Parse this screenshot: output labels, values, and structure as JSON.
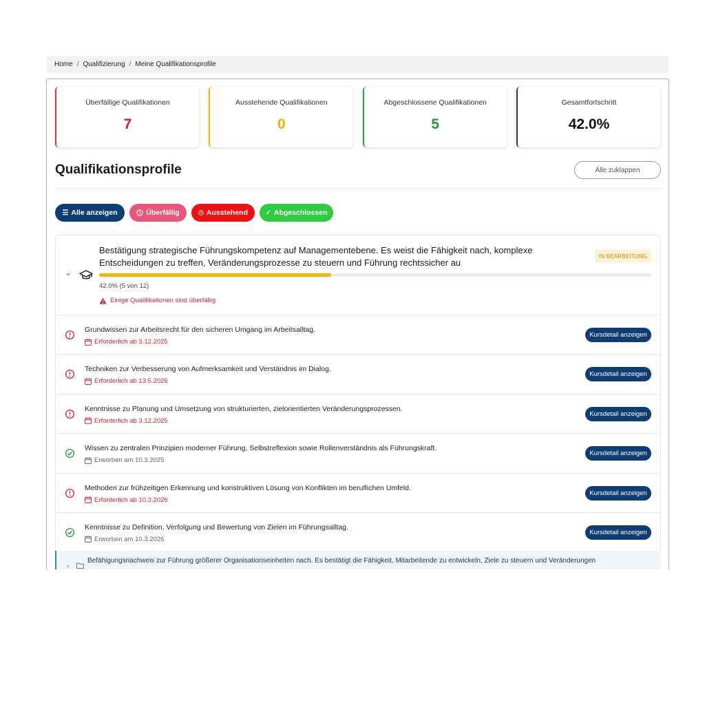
{
  "breadcrumb": [
    "Home",
    "Qualifizierung",
    "Meine Qualifikationsprofile"
  ],
  "stats": [
    {
      "label": "Überfällige Qualifikationen",
      "value": "7",
      "color": "#dc3545"
    },
    {
      "label": "Ausstehende Qualifikationen",
      "value": "0",
      "color": "#f5b800"
    },
    {
      "label": "Abgeschlossene Qualifikationen",
      "value": "5",
      "color": "#28a745"
    },
    {
      "label": "Gesamtfortschritt",
      "value": "42.0%",
      "color": "#2f3e4e"
    }
  ],
  "section": {
    "title": "Qualifikationsprofile",
    "collapse_label": "Alle zuklappen"
  },
  "filters": [
    {
      "label": "Alle anzeigen",
      "icon": "list-icon"
    },
    {
      "label": "Überfällig",
      "icon": "alert-circle-icon"
    },
    {
      "label": "Ausstehend",
      "icon": "clock-icon"
    },
    {
      "label": "Abgeschlossen",
      "icon": "check-icon"
    }
  ],
  "profile": {
    "title": "Bestätigung strategische Führungskompetenz auf Managementebene. Es weist die Fähigkeit nach, komplexe Entscheidungen zu treffen, Veränderungsprozesse zu steuern und Führung rechtssicher au",
    "status_badge": "IN BEARBEITUNG",
    "progress_fraction": 0.42,
    "progress_text": "42.0% (5 von 12)",
    "warning": "Einige Qualifikationen sind überfällig",
    "icon": "graduation-cap-icon"
  },
  "items": [
    {
      "title": "Grundwissen zur Arbeitsrecht für den sicheren Umgang im Arbeitsalltag.",
      "date": "Erforderlich ab 3.12.2025",
      "status": "overdue",
      "button": "Kursdetail anzeigen"
    },
    {
      "title": "Techniken zur Verbesserung von Aufmerksamkeit und Verständnis im Dialog.",
      "date": "Erforderlich ab 13.5.2026",
      "status": "overdue",
      "button": "Kursdetail anzeigen"
    },
    {
      "title": "Kenntnisse zu Planung und Umsetzung von strukturierten, zielorientierten Veränderungsprozessen.",
      "date": "Erforderlich ab 3.12.2025",
      "status": "overdue",
      "button": "Kursdetail anzeigen"
    },
    {
      "title": "Wissen zu zentralen Prinzipien moderner Führung, Selbstreflexion sowie Rollenverständnis als Führungskraft.",
      "date": "Erworben am 10.3.2025",
      "status": "done",
      "button": "Kursdetail anzeigen"
    },
    {
      "title": "Methoden zur frühzeitigen Erkennung und konstruktiven Lösung von Konflikten im beruflichen Umfeld.",
      "date": "Erforderlich ab 10.3.2026",
      "status": "overdue",
      "button": "Kursdetail anzeigen"
    },
    {
      "title": "Kenntnisse zu Definition, Verfolgung und Bewertung von Zielen im Führungsalltag.",
      "date": "Erworben am 10.3.2026",
      "status": "done",
      "button": "Kursdetail anzeigen"
    }
  ],
  "profile2": {
    "title": "Befähigungsnachweis zur Führung größerer Organisationseinheiten nach. Es bestätigt die Fähigkeit, Mitarbeitende zu entwickeln, Ziele zu steuern und Veränderungen"
  }
}
